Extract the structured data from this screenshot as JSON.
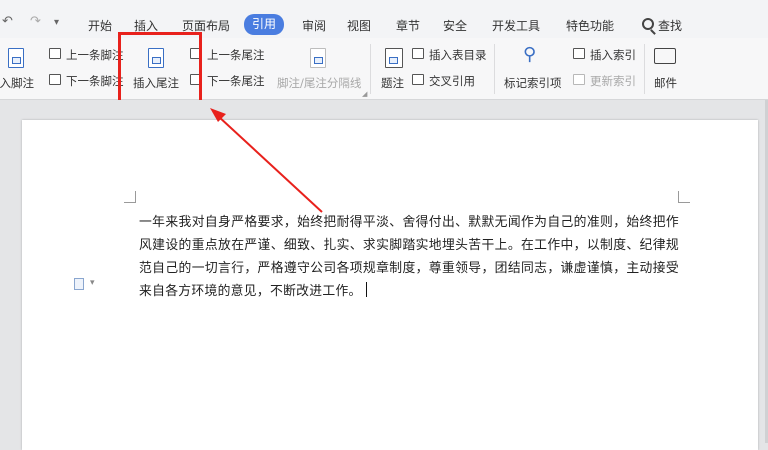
{
  "quick_access": {
    "undo_icon": "undo-icon",
    "redo_icon": "redo-icon",
    "more_icon": "chevron-down-icon"
  },
  "menu": {
    "tabs": [
      "开始",
      "插入",
      "页面布局",
      "引用",
      "审阅",
      "视图",
      "章节",
      "安全",
      "开发工具",
      "特色功能"
    ],
    "active_tab": "引用",
    "search_label": "查找"
  },
  "ribbon": {
    "insert_footnote": "插入脚注",
    "prev_footnote": "上一条脚注",
    "next_footnote": "下一条脚注",
    "insert_endnote": "插入尾注",
    "prev_endnote": "上一条尾注",
    "next_endnote": "下一条尾注",
    "separator": "脚注/尾注分隔线",
    "caption": "题注",
    "insert_table_of_figures": "插入表目录",
    "cross_reference": "交叉引用",
    "mark_index_entry": "标记索引项",
    "insert_index": "插入索引",
    "update_index": "更新索引",
    "mail": "邮件"
  },
  "document": {
    "paragraph": "一年来我对自身严格要求，始终把耐得平淡、舍得付出、默默无闻作为自己的准则，始终把作风建设的重点放在严谨、细致、扎实、求实脚踏实地埋头苦干上。在工作中，以制度、纪律规范自己的一切言行，严格遵守公司各项规章制度，尊重领导，团结同志，谦虚谨慎，主动接受来自各方环境的意见，不断改进工作。"
  },
  "annotation": {
    "highlight_color": "#e8211c",
    "arrow_color": "#e8211c"
  },
  "colors": {
    "accent": "#4a7de0"
  }
}
